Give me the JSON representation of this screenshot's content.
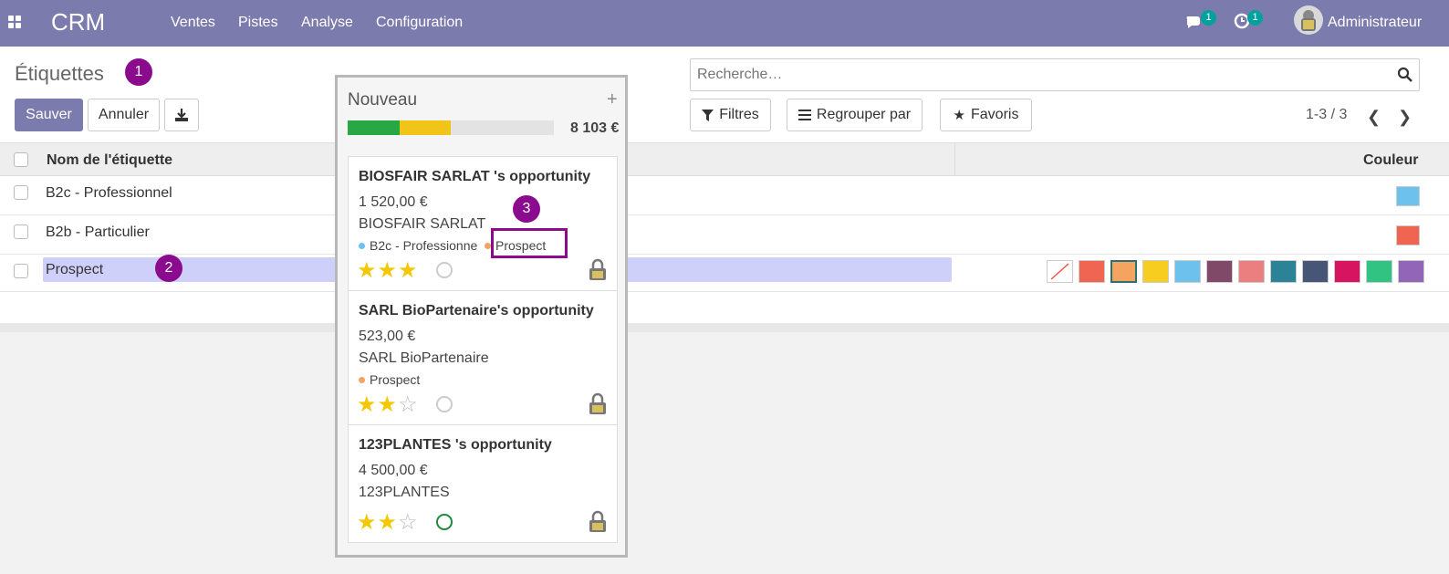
{
  "app": {
    "name": "CRM",
    "menu": [
      "Ventes",
      "Pistes",
      "Analyse",
      "Configuration"
    ],
    "messages_count": "1",
    "activities_count": "1",
    "user": "Administrateur"
  },
  "control": {
    "title": "Étiquettes",
    "save_label": "Sauver",
    "cancel_label": "Annuler",
    "search_placeholder": "Recherche…",
    "filters_label": "Filtres",
    "groupby_label": "Regrouper par",
    "favorites_label": "Favoris",
    "pager": "1-3 / 3"
  },
  "list": {
    "columns": [
      "Nom de l'étiquette",
      "Couleur"
    ],
    "rows": [
      {
        "name": "B2c - Professionnel",
        "color": "#6cc1ed"
      },
      {
        "name": "B2b - Particulier",
        "color": "#ef6552"
      },
      {
        "name": "Prospect",
        "color": "#f4a460"
      }
    ],
    "palette": [
      "#ef6552",
      "#f4a460",
      "#f7cd1f",
      "#6cc1ed",
      "#814968",
      "#eb7e7f",
      "#2c8397",
      "#475577",
      "#d6145f",
      "#30c381",
      "#9365b8"
    ]
  },
  "markers": [
    "1",
    "2",
    "3"
  ],
  "kanban": {
    "column_title": "Nouveau",
    "add_symbol": "+",
    "total": "8 103 €",
    "progress": {
      "green_fraction": 0.25,
      "yellow_fraction": 0.25
    },
    "cards": [
      {
        "title": "BIOSFAIR SARLAT 's opportunity",
        "amount": "1 520,00 €",
        "customer": "BIOSFAIR SARLAT",
        "tags": [
          {
            "label": "B2c - Professionne",
            "color": "#6cc1ed"
          },
          {
            "label": "Prospect",
            "color": "#f4a460"
          }
        ],
        "stars": 3,
        "activity": "none"
      },
      {
        "title": "SARL BioPartenaire's opportunity",
        "amount": "523,00 €",
        "customer": "SARL BioPartenaire",
        "tags": [
          {
            "label": "Prospect",
            "color": "#f4a460"
          }
        ],
        "stars": 2,
        "activity": "none"
      },
      {
        "title": "123PLANTES 's opportunity",
        "amount": "4 500,00 €",
        "customer": "123PLANTES",
        "tags": [],
        "stars": 2,
        "activity": "planned"
      }
    ]
  },
  "colors": {
    "brand": "#7c7bad",
    "marker": "#8b0b8f",
    "badge": "#00a09d"
  }
}
